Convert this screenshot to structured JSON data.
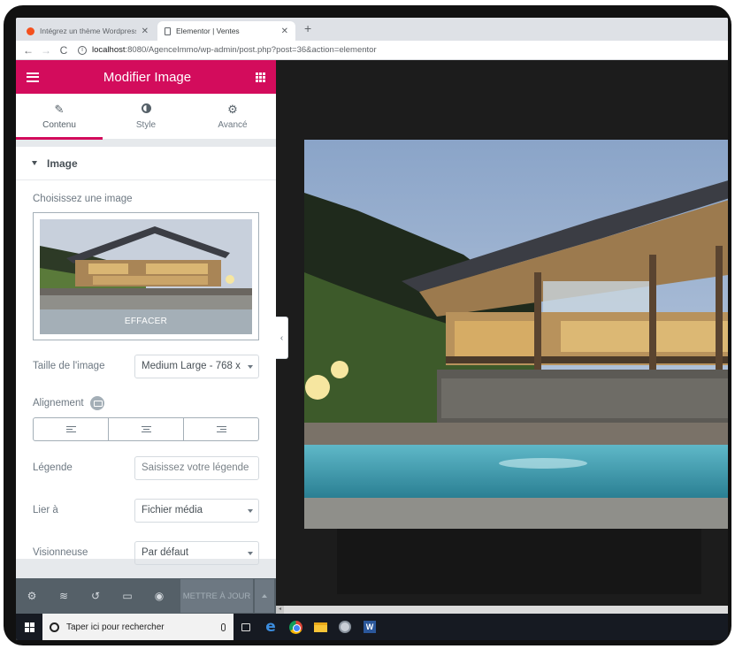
{
  "browser": {
    "tabs": [
      {
        "title": "Intégrez un thème Wordpress p",
        "active": false
      },
      {
        "title": "Elementor | Ventes",
        "active": true
      }
    ],
    "url_host": "localhost",
    "url_rest": ":8080/AgenceImmo/wp-admin/post.php?post=36&action=elementor"
  },
  "panel": {
    "title": "Modifier Image",
    "tabs": [
      {
        "label": "Contenu",
        "icon": "pencil-icon"
      },
      {
        "label": "Style",
        "icon": "half-circle-icon"
      },
      {
        "label": "Avancé",
        "icon": "gear-icon"
      }
    ],
    "section_title": "Image",
    "choose_label": "Choisissez une image",
    "clear_label": "EFFACER",
    "image_size_label": "Taille de l'image",
    "image_size_value": "Medium Large - 768 x",
    "alignment_label": "Alignement",
    "caption_label": "Légende",
    "caption_placeholder": "Saisissez votre légende",
    "link_label": "Lier à",
    "link_value": "Fichier média",
    "lightbox_label": "Visionneuse",
    "lightbox_value": "Par défaut",
    "update_label": "METTRE À JOUR"
  },
  "taskbar": {
    "search_placeholder": "Taper ici pour rechercher"
  },
  "colors": {
    "elementor_pink": "#d30c5c",
    "panel_footer": "#556068",
    "preview_bg": "#1c1c1c"
  }
}
